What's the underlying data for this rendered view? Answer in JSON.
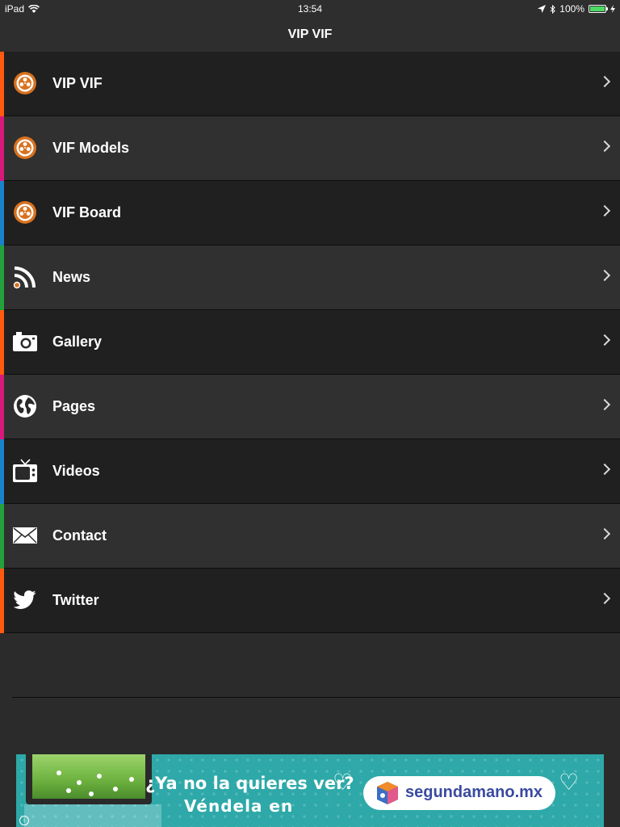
{
  "status_bar": {
    "device": "iPad",
    "time": "13:54",
    "battery_text": "100%",
    "battery_level": 1.0
  },
  "nav": {
    "title": "VIP VIF"
  },
  "colors": {
    "accent_orange": "#ff5a10",
    "accent_magenta": "#d8187a",
    "accent_blue": "#1a82c8",
    "accent_green": "#24a03c",
    "logo_orange": "#d8721e"
  },
  "menu": {
    "items": [
      {
        "label": "VIP VIF",
        "icon": "film-reel-icon",
        "accent": "#ff5a10"
      },
      {
        "label": "VIF Models",
        "icon": "film-reel-icon",
        "accent": "#d8187a"
      },
      {
        "label": "VIF Board",
        "icon": "film-reel-icon",
        "accent": "#1a82c8"
      },
      {
        "label": "News",
        "icon": "rss-icon",
        "accent": "#24a03c"
      },
      {
        "label": "Gallery",
        "icon": "camera-icon",
        "accent": "#ff5a10"
      },
      {
        "label": "Pages",
        "icon": "globe-icon",
        "accent": "#d8187a"
      },
      {
        "label": "Videos",
        "icon": "tv-icon",
        "accent": "#1a82c8"
      },
      {
        "label": "Contact",
        "icon": "envelope-icon",
        "accent": "#24a03c"
      },
      {
        "label": "Twitter",
        "icon": "twitter-bird-icon",
        "accent": "#ff5a10"
      }
    ]
  },
  "ad": {
    "headline": "¿Ya no la quieres ver?",
    "subline": "Véndela en",
    "brand": "segundamano.mx",
    "info_icon": "i"
  }
}
